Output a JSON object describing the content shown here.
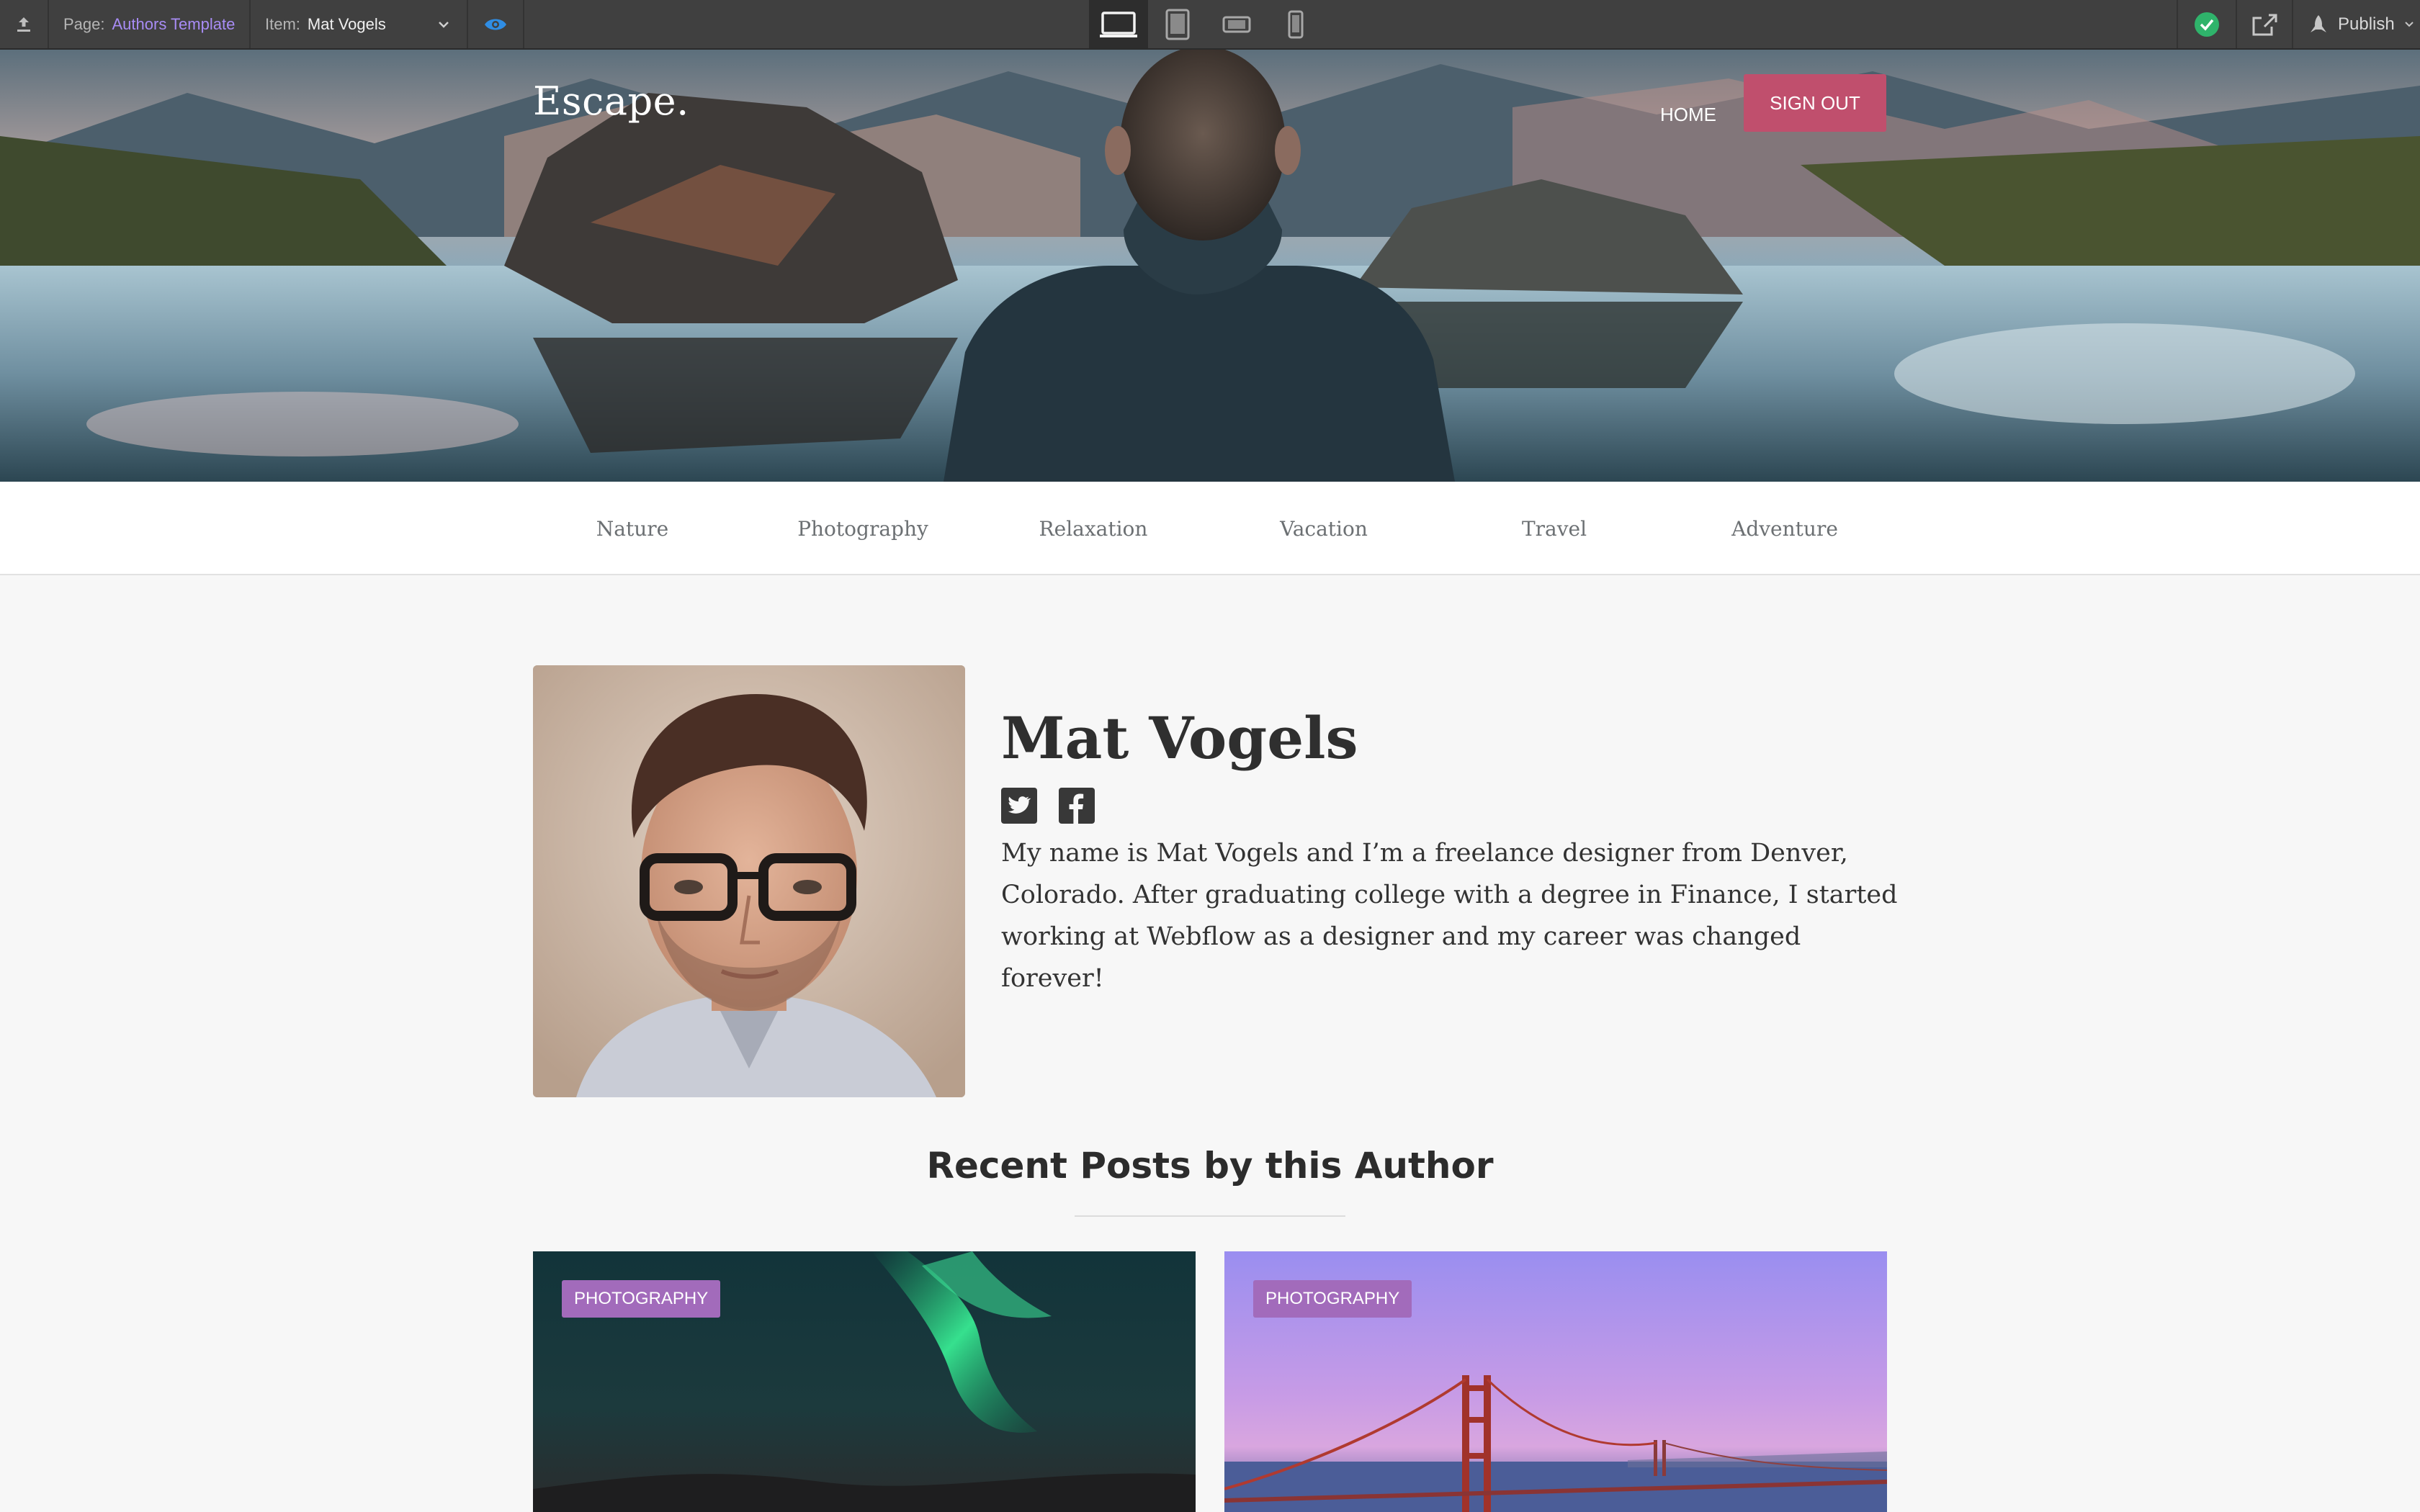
{
  "toolbar": {
    "page_label": "Page:",
    "page_value": "Authors Template",
    "item_label": "Item:",
    "item_value": "Mat Vogels",
    "publish_label": "Publish"
  },
  "site": {
    "logo": "Escape.",
    "nav": {
      "home": "HOME",
      "signout": "SIGN OUT"
    },
    "categories": [
      "Nature",
      "Photography",
      "Relaxation",
      "Vacation",
      "Travel",
      "Adventure"
    ]
  },
  "author": {
    "name": "Mat Vogels",
    "bio": "My name is Mat Vogels and I’m a freelance designer from Denver, Colorado. After graduating college with a degree in Finance, I started working at Webflow as a designer and my career was changed forever!"
  },
  "recent": {
    "title": "Recent Posts by this Author",
    "posts": [
      {
        "tag": "PHOTOGRAPHY"
      },
      {
        "tag": "PHOTOGRAPHY"
      }
    ]
  },
  "colors": {
    "toolbar_bg": "#404040",
    "signout_bg": "#c04f6d",
    "tag_bg": "#a26bbb",
    "page_link": "#a88cf5",
    "publish_ok": "#2fb36b"
  }
}
